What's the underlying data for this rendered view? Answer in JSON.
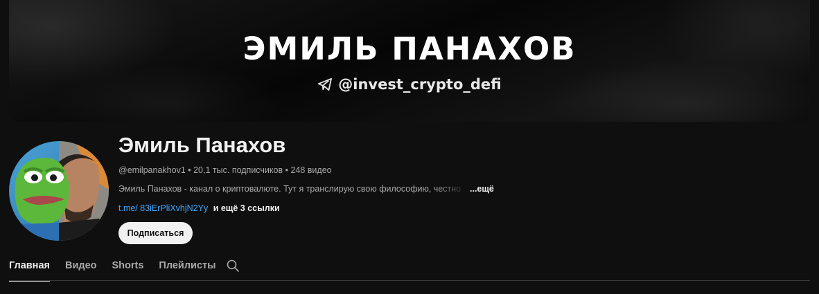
{
  "banner": {
    "title": "ЭМИЛЬ ПАНАХОВ",
    "handle": "@invest_crypto_defi",
    "icon": "telegram-icon"
  },
  "channel": {
    "name": "Эмиль Панахов",
    "handle": "@emilpanakhov1",
    "separator": " • ",
    "subscribers": "20,1 тыс. подписчиков",
    "videos": "248 видео",
    "description": "Эмиль Панахов - канал о криптовалюте. Тут я транслирую свою философию, честно",
    "more_label": "...ещё",
    "link_text": "t.me/ 83iErPliXvhjN2Yy",
    "more_links_label": "и ещё 3 ссылки",
    "subscribe_label": "Подписаться"
  },
  "tabs": [
    {
      "label": "Главная",
      "active": true
    },
    {
      "label": "Видео",
      "active": false
    },
    {
      "label": "Shorts",
      "active": false
    },
    {
      "label": "Плейлисты",
      "active": false
    }
  ],
  "icons": {
    "search": "search-icon"
  },
  "colors": {
    "background": "#0f0f0f",
    "link": "#3ea6ff",
    "secondary_text": "#aaaaaa",
    "primary_text": "#f1f1f1"
  }
}
